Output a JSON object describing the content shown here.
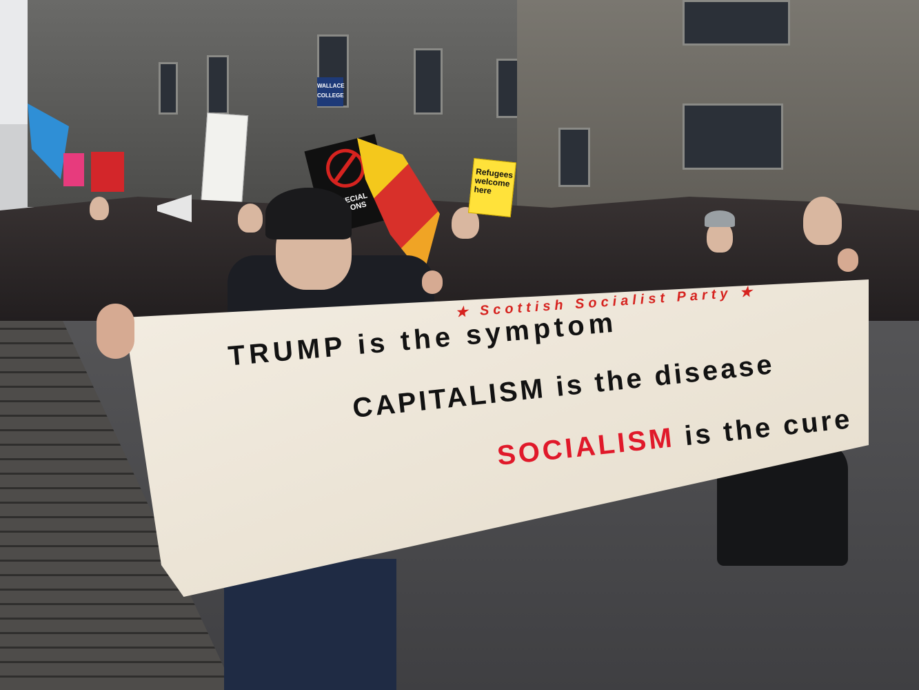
{
  "image": {
    "description_hidden": "",
    "banner": {
      "party": "★ Scottish Socialist Party ★",
      "line1": "TRUMP is the symptom",
      "line2": "CAPITALISM is the disease",
      "line3_red": "SOCIALISM",
      "line3_rest": " is the cure"
    },
    "placards": {
      "refugees": "Refugees welcome here",
      "no_special": "NO SPECIAL RELATIONS"
    },
    "signage": {
      "wallace": "WALLACE COLLEGE"
    }
  }
}
